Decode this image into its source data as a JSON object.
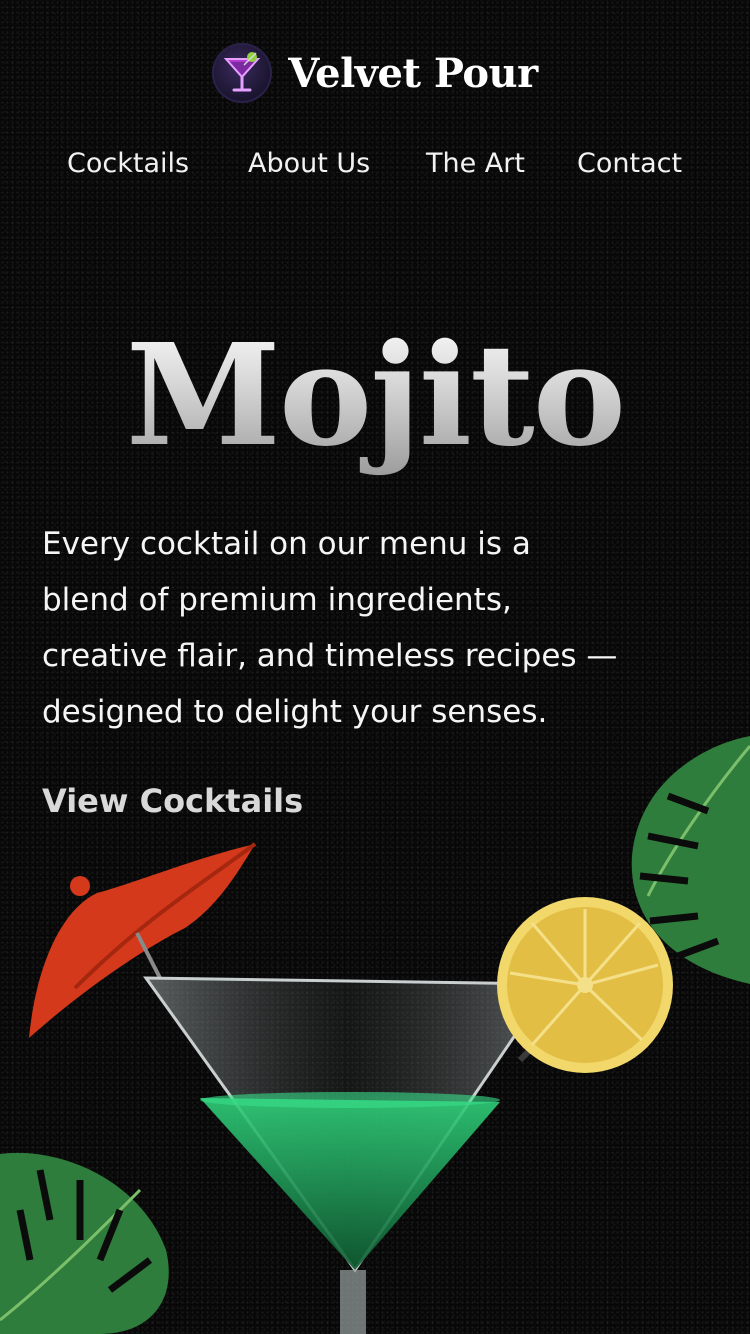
{
  "header": {
    "brand": "Velvet Pour",
    "logo_icon": "cocktail-glass-logo-icon"
  },
  "nav": {
    "items": [
      {
        "label": "Cocktails"
      },
      {
        "label": "About Us"
      },
      {
        "label": "The Art"
      },
      {
        "label": "Contact"
      }
    ]
  },
  "hero": {
    "title": "Mojito",
    "body": "Every cocktail on our menu is a blend of premium ingredients, creative flair, and timeless recipes — designed to delight your senses.",
    "cta_label": "View Cocktails"
  },
  "illustration": {
    "items": [
      "cocktail-umbrella",
      "martini-glass",
      "lemon-slice",
      "monstera-leaf"
    ]
  },
  "colors": {
    "background": "#0b0b0b",
    "text": "#ffffff",
    "cta": "#d9d9d9",
    "leaf": "#2f7d3c",
    "umbrella": "#d4391c",
    "lemon": "#e8c44b",
    "liquid": "#1fb86a"
  }
}
